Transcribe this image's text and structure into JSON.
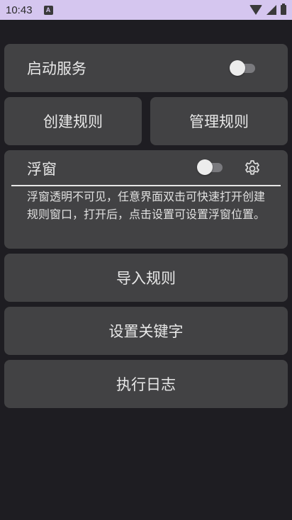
{
  "status_bar": {
    "time": "10:43",
    "notification_icon": "A"
  },
  "service": {
    "label": "启动服务",
    "toggle_on": false
  },
  "buttons": {
    "create_rule": "创建规则",
    "manage_rule": "管理规则",
    "import_rule": "导入规则",
    "set_keyword": "设置关键字",
    "exec_log": "执行日志"
  },
  "float_window": {
    "title": "浮窗",
    "toggle_on": false,
    "description": "浮窗透明不可见，任意界面双击可快速打开创建规则窗口，打开后，点击设置可设置浮窗位置。"
  },
  "colors": {
    "background": "#1e1d22",
    "card": "#424244",
    "status_bar": "#d5c6ef"
  },
  "icons": [
    "wifi-icon",
    "signal-icon",
    "battery-icon",
    "gear-icon"
  ]
}
